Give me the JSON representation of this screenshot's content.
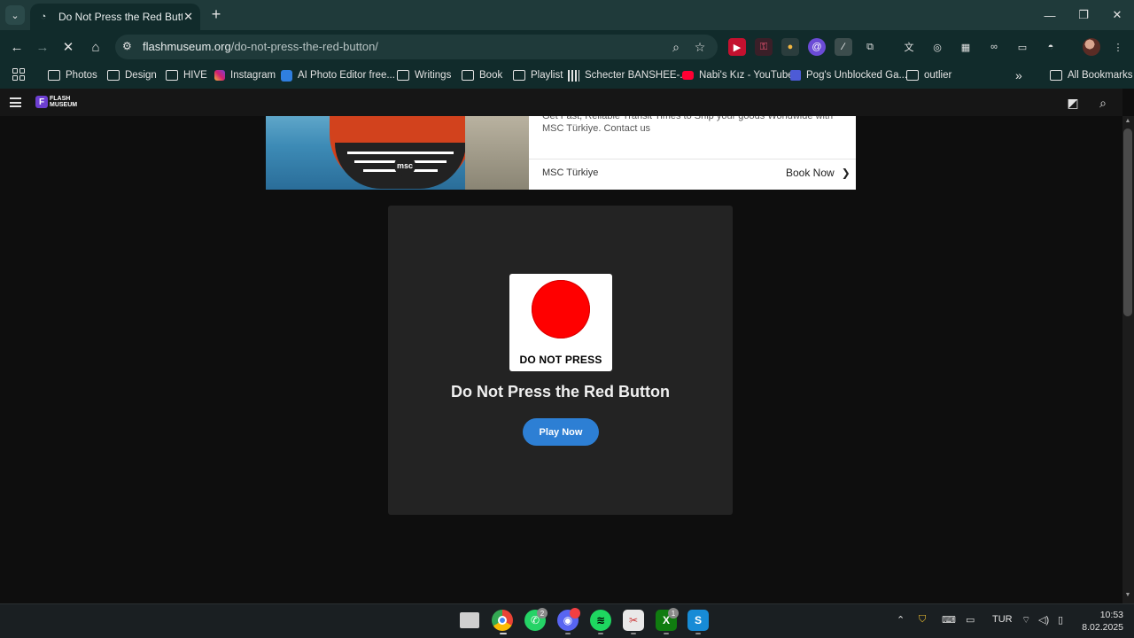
{
  "browser": {
    "tab_title": "Do Not Press the Red Button - F",
    "url_host": "flashmuseum.org",
    "url_path": "/do-not-press-the-red-button/"
  },
  "bookmarks": [
    {
      "label": "Photos",
      "icon": "folder-icon"
    },
    {
      "label": "Design",
      "icon": "folder-icon"
    },
    {
      "label": "HIVE",
      "icon": "folder-icon"
    },
    {
      "label": "Instagram",
      "icon": "instagram-icon"
    },
    {
      "label": "AI Photo Editor free...",
      "icon": "ai-editor-icon"
    },
    {
      "label": "Writings",
      "icon": "folder-icon"
    },
    {
      "label": "Book",
      "icon": "folder-icon"
    },
    {
      "label": "Playlist",
      "icon": "folder-icon"
    },
    {
      "label": "Schecter BANSHEE-...",
      "icon": "guitar-icon"
    },
    {
      "label": "Nabi's Kız - YouTube",
      "icon": "youtube-icon"
    },
    {
      "label": "Pog's Unblocked Ga...",
      "icon": "game-icon"
    },
    {
      "label": "outlier",
      "icon": "folder-icon"
    }
  ],
  "all_bookmarks": "All Bookmarks",
  "site": {
    "logo_line1": "FLASH",
    "logo_line2": "MUSEUM"
  },
  "ad": {
    "description": "Get Fast, Reliable Transit Times to Ship your goods Worldwide with MSC Türkiye. Contact us",
    "brand": "MSC Türkiye",
    "cta": "Book Now",
    "ship_logo": "msc"
  },
  "game": {
    "thumbnail_label": "DO NOT PRESS",
    "title": "Do Not Press the Red Button",
    "play_label": "Play Now"
  },
  "taskbar": {
    "whatsapp_badge": "2",
    "xbox_badge": "1",
    "language": "TUR",
    "time": "10:53",
    "date": "8.02.2025"
  },
  "colors": {
    "tab_bar": "#1f3a3a",
    "toolbar": "#112b2b",
    "page_bg": "#0e0e0e",
    "card_bg": "#232323",
    "red_button": "#ff0000",
    "play_button": "#2d7fd4"
  }
}
